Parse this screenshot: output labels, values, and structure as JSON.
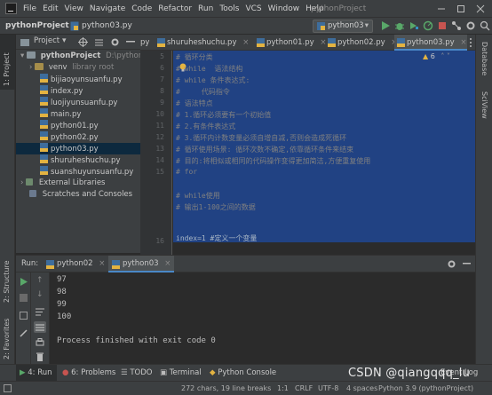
{
  "window": {
    "menu": [
      "File",
      "Edit",
      "View",
      "Navigate",
      "Code",
      "Refactor",
      "Run",
      "Tools",
      "VCS",
      "Window",
      "Help"
    ],
    "title": "pythonProject"
  },
  "nav": {
    "project": "pythonProject",
    "file": "python03.py",
    "run_config": "python03"
  },
  "left_stripe": {
    "project": "1: Project",
    "structure": "2: Structure",
    "favorites": "2: Favorites"
  },
  "right_stripe": {
    "database": "Database",
    "sciview": "SciView"
  },
  "project_panel": {
    "title": "Project",
    "root_name": "pythonProject",
    "root_path": "D:\\pythonPr",
    "venv": "venv",
    "venv_hint": "library root",
    "files": [
      "bijiaoyunsuanfu.py",
      "index.py",
      "luojiyunsuanfu.py",
      "main.py",
      "python01.py",
      "python02.py",
      "python03.py",
      "shuruheshuchu.py",
      "suanshuyunsuanfu.py"
    ],
    "external": "External Libraries",
    "scratches": "Scratches and Consoles"
  },
  "tabs": [
    "py",
    "shuruheshuchu.py",
    "python01.py",
    "python02.py",
    "python03.py"
  ],
  "editor": {
    "inspection_count": "6",
    "line_numbers": [
      "5",
      "6",
      "7",
      "8",
      "9",
      "10",
      "11",
      "12",
      "13",
      "14",
      "15",
      "16"
    ],
    "lines": [
      "# 循环分类",
      "# while  语法结构",
      "# while 条件表达式:",
      "#     代码指令",
      "# 语法特点",
      "# 1.循环必须要有一个初始值",
      "# 2.有条件表达式",
      "# 3.循环内计数变量必须自增自减,否则会造成死循环",
      "# 循环使用场景: 循环次数不确定,依靠循环条件来结束",
      "# 目的:将相似或相同的代码操作变得更加简洁,方便重复使用",
      "# for",
      "",
      "# while使用",
      "# 输出1-100之间的数据",
      "",
      "index=1 #定义一个变量"
    ]
  },
  "run_panel": {
    "label": "Run:",
    "tabs": [
      "python02",
      "python03"
    ],
    "output": [
      "97",
      "98",
      "99",
      "100",
      "",
      "Process finished with exit code 0"
    ]
  },
  "bottom_tools": [
    "4: Run",
    "6: Problems",
    "TODO",
    "Terminal",
    "Python Console",
    "Event Log"
  ],
  "status": {
    "info": "272 chars, 19 line breaks",
    "position": "1:1",
    "line_sep": "CRLF",
    "encoding": "UTF-8",
    "indent": "4 spaces",
    "interpreter": "Python 3.9 (pythonProject)"
  },
  "watermark": "CSDN @qiangqqq_lu",
  "colors": {
    "accent": "#4a88c7",
    "run_green": "#59a869",
    "selection": "#214283",
    "comment": "#808080"
  }
}
